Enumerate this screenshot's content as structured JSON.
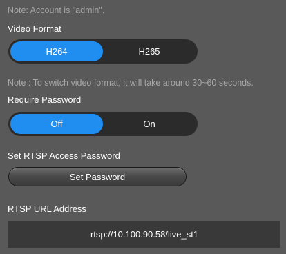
{
  "notes": {
    "account": "Note: Account is \"admin\".",
    "switch_format": "Note : To switch video format, it will take around 30~60 seconds."
  },
  "video_format": {
    "label": "Video Format",
    "options": [
      "H264",
      "H265"
    ],
    "selected": "H264"
  },
  "require_password": {
    "label": "Require Password",
    "options": [
      "Off",
      "On"
    ],
    "selected": "Off"
  },
  "rtsp_password": {
    "label": "Set RTSP Access Password",
    "button_label": "Set Password"
  },
  "rtsp_url": {
    "label": "RTSP URL Address",
    "value": "rtsp://10.100.90.58/live_st1"
  },
  "colors": {
    "background": "#595959",
    "active_segment": "#1f8ef0",
    "toggle_track": "#2b2b2b",
    "url_box": "#393939",
    "note_text": "#a6a6a6"
  }
}
